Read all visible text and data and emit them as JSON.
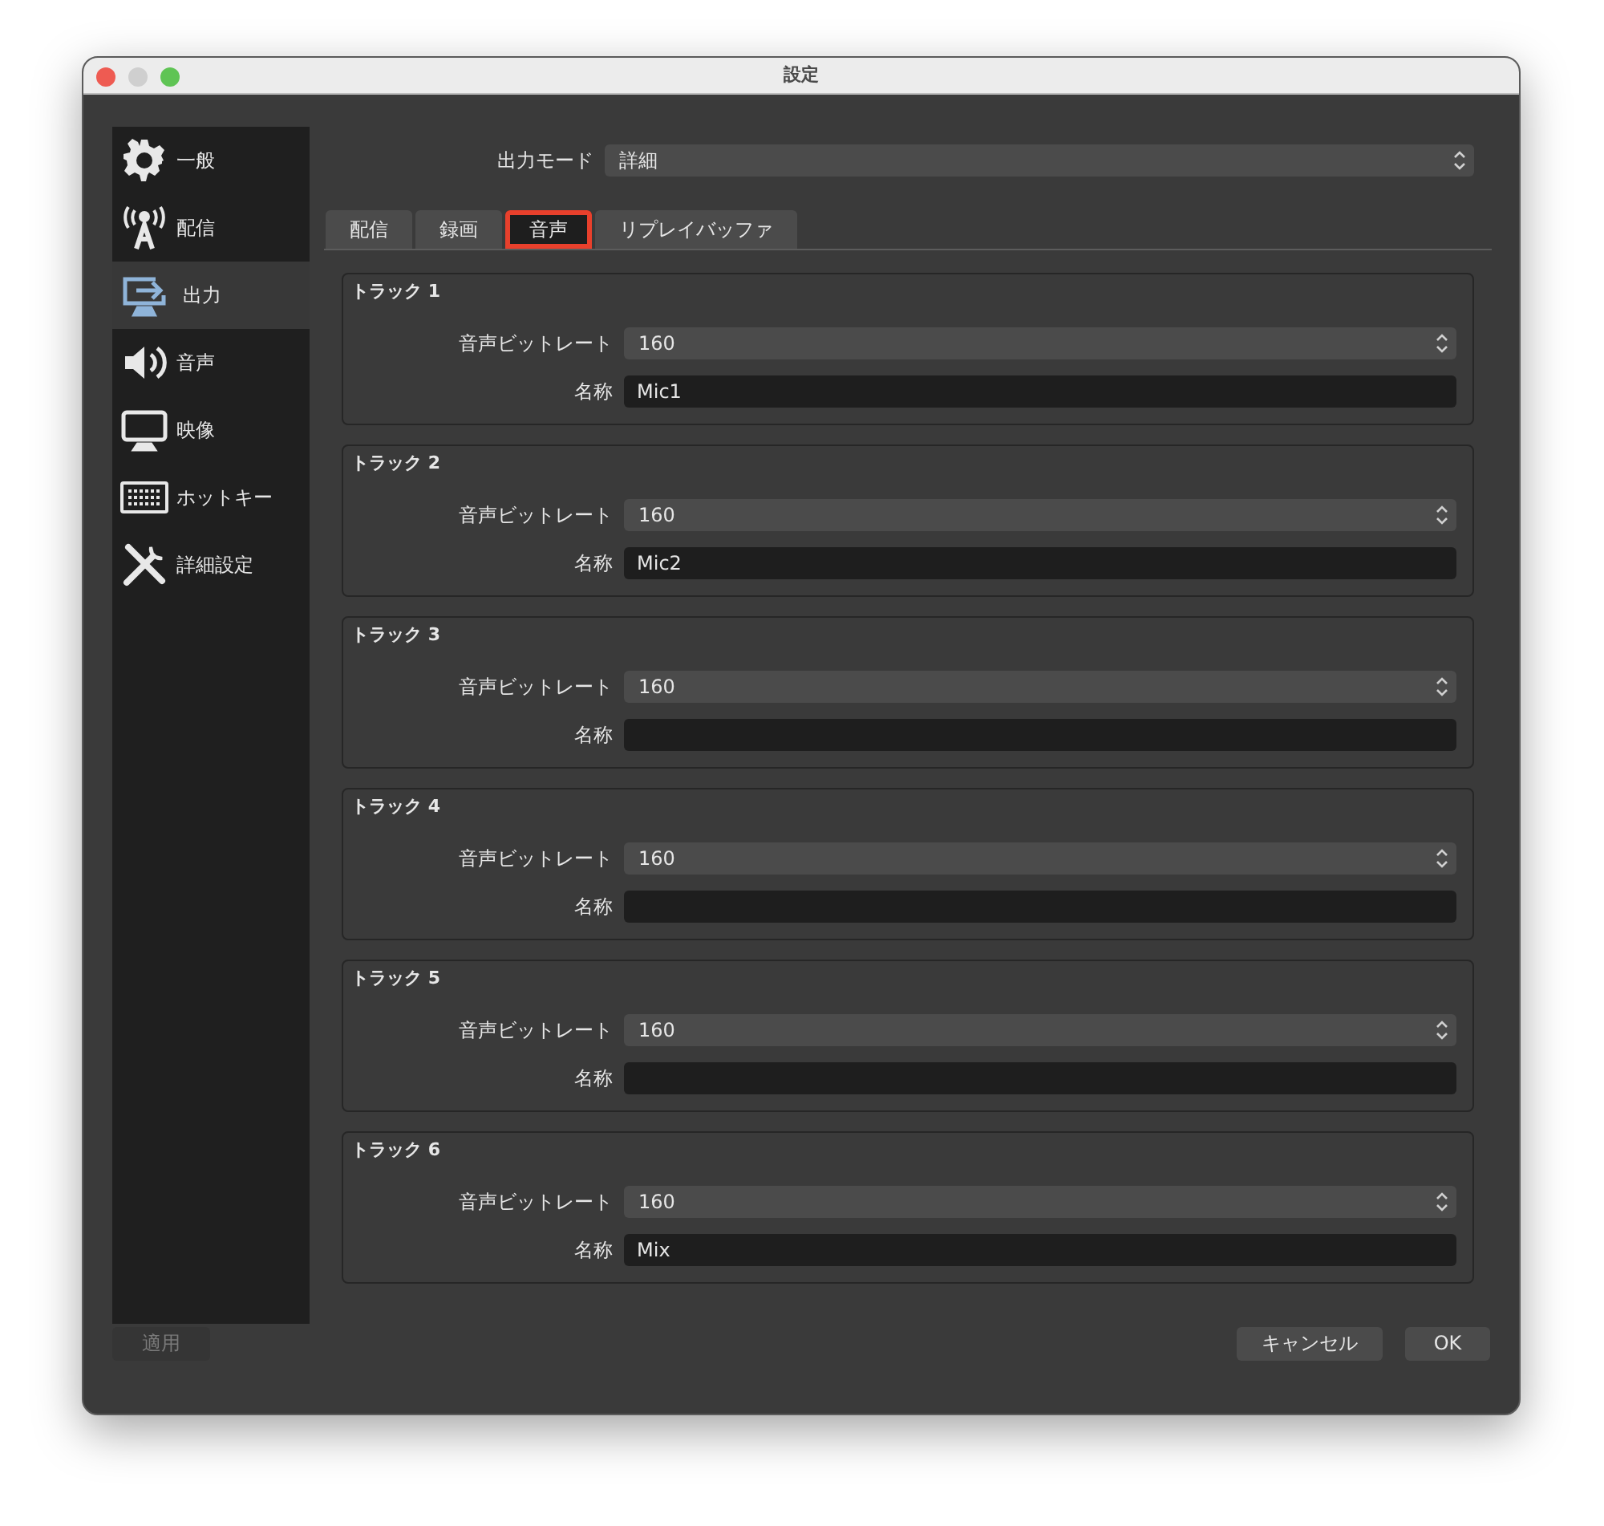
{
  "window": {
    "title": "設定"
  },
  "sidebar": {
    "items": [
      {
        "kind": "gear",
        "label": "一般",
        "selected": false
      },
      {
        "kind": "antenna",
        "label": "配信",
        "selected": false
      },
      {
        "kind": "output",
        "label": "出力",
        "selected": true
      },
      {
        "kind": "speaker",
        "label": "音声",
        "selected": false
      },
      {
        "kind": "monitor",
        "label": "映像",
        "selected": false
      },
      {
        "kind": "keyboard",
        "label": "ホットキー",
        "selected": false
      },
      {
        "kind": "tools",
        "label": "詳細設定",
        "selected": false
      }
    ]
  },
  "output_mode": {
    "label": "出力モード",
    "value": "詳細"
  },
  "tabs": [
    {
      "label": "配信",
      "selected": false,
      "highlighted": false
    },
    {
      "label": "録画",
      "selected": false,
      "highlighted": false
    },
    {
      "label": "音声",
      "selected": true,
      "highlighted": true
    },
    {
      "label": "リプレイバッファ",
      "selected": false,
      "highlighted": false
    }
  ],
  "tracks": [
    {
      "title": "トラック 1",
      "bitrate_label": "音声ビットレート",
      "bitrate": "160",
      "name_label": "名称",
      "name": "Mic1"
    },
    {
      "title": "トラック 2",
      "bitrate_label": "音声ビットレート",
      "bitrate": "160",
      "name_label": "名称",
      "name": "Mic2"
    },
    {
      "title": "トラック 3",
      "bitrate_label": "音声ビットレート",
      "bitrate": "160",
      "name_label": "名称"
    },
    {
      "title": "トラック 4",
      "bitrate_label": "音声ビットレート",
      "bitrate": "160",
      "name_label": "名称"
    },
    {
      "title": "トラック 5",
      "bitrate_label": "音声ビットレート",
      "bitrate": "160",
      "name_label": "名称"
    },
    {
      "title": "トラック 6",
      "bitrate_label": "音声ビットレート",
      "bitrate": "160",
      "name_label": "名称",
      "name": "Mix"
    }
  ],
  "footer": {
    "apply": {
      "label": "適用",
      "disabled": true
    },
    "cancel": {
      "label": "キャンセル"
    },
    "ok": {
      "label": "OK"
    }
  }
}
